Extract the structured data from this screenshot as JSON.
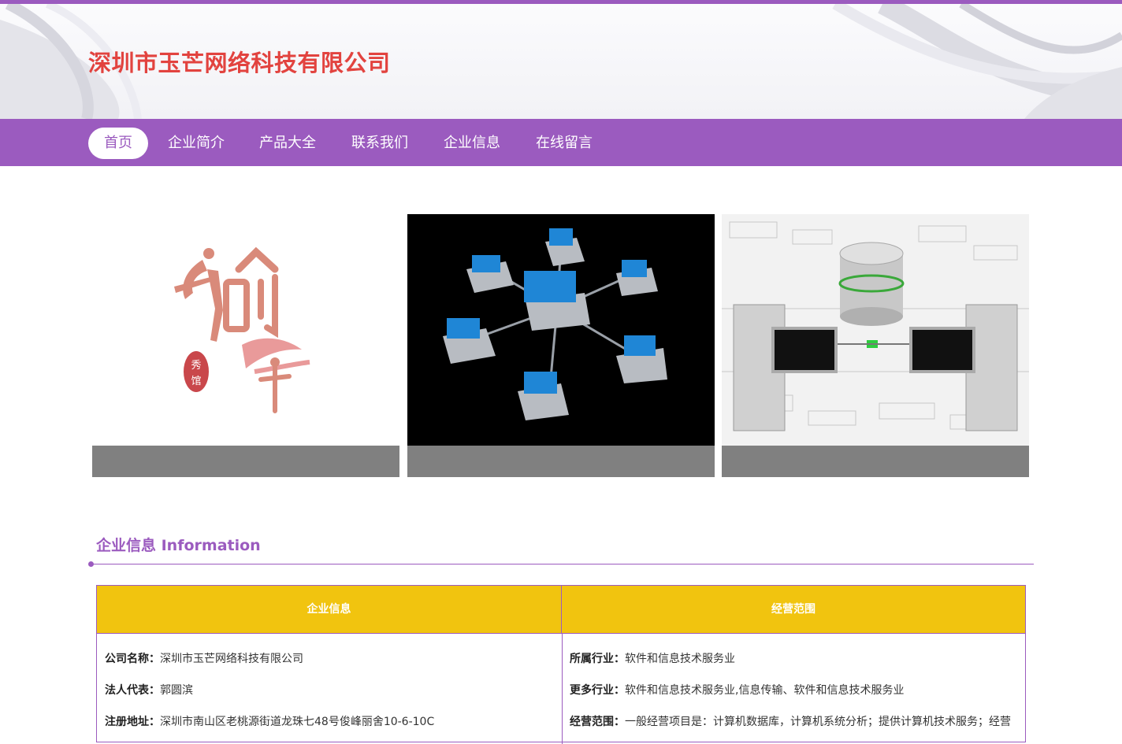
{
  "header": {
    "company_title": "深圳市玉芒网络科技有限公司"
  },
  "nav": {
    "items": [
      "首页",
      "企业简介",
      "产品大全",
      "联系我们",
      "企业信息",
      "在线留言"
    ],
    "active": "首页"
  },
  "gallery": {
    "logo": {
      "text_main": "愉年",
      "stamp_text": "秀馆"
    },
    "network_image": "network-topology-image",
    "database_image": "database-servers-image"
  },
  "section": {
    "title": "企业信息 Information"
  },
  "table": {
    "headers": [
      "企业信息",
      "经营范围"
    ],
    "left_rows": [
      {
        "key": "公司名称：",
        "value": "深圳市玉芒网络科技有限公司"
      },
      {
        "key": "法人代表：",
        "value": "郭圆滨"
      },
      {
        "key": "注册地址：",
        "value": "深圳市南山区老桃源街道龙珠七48号俊峰丽舍10-6-10C"
      }
    ],
    "right_rows": [
      {
        "key": "所属行业：",
        "value": "软件和信息技术服务业"
      },
      {
        "key": "更多行业：",
        "value": "软件和信息技术服务业,信息传输、软件和信息技术服务业"
      },
      {
        "key": "经营范围：",
        "value": "一般经营项目是：计算机数据库，计算机系统分析；提供计算机技术服务；经营"
      }
    ]
  },
  "colors": {
    "brand_purple": "#9b5bbf",
    "title_red": "#e2433f",
    "table_header": "#f1c40f",
    "caption_gray": "#808080"
  }
}
